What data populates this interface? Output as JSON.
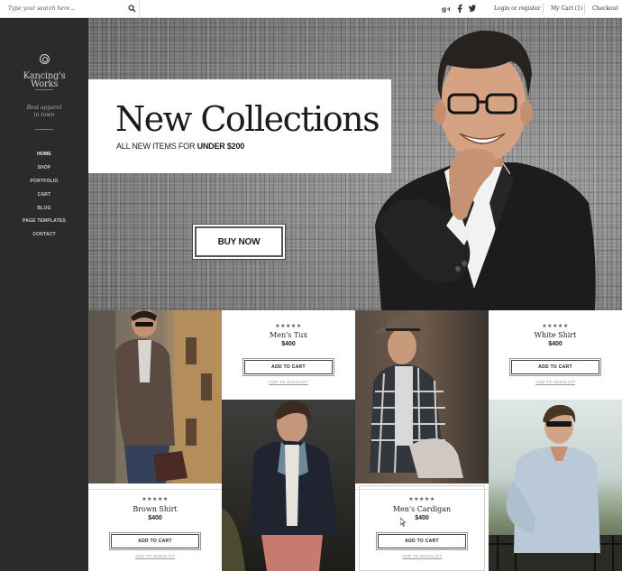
{
  "search": {
    "placeholder": "Type your search here..."
  },
  "header": {
    "social": [
      "google-plus-icon",
      "facebook-icon",
      "twitter-icon"
    ],
    "login": "Login or register",
    "cart": "My Cart (1)",
    "checkout": "Checkout"
  },
  "brand": {
    "line1": "Kancing's",
    "line2": "Works",
    "tagline1": "Best apparel",
    "tagline2": "in town"
  },
  "nav": [
    "HOME",
    "SHOP",
    "PORTFOLIO",
    "CART",
    "BLOG",
    "PAGE TEMPLATES",
    "CONTACT"
  ],
  "hero": {
    "title": "New Collections",
    "subtitle_prefix": "ALL NEW ITEMS FOR ",
    "subtitle_strong": "UNDER $200",
    "button": "BUY NOW"
  },
  "products": [
    {
      "name": "Men's Tux",
      "price": "$400",
      "rating": "★★★★★",
      "add": "ADD TO CART",
      "wish": "ADD TO WISHLIST"
    },
    {
      "name": "White Shirt",
      "price": "$400",
      "rating": "★★★★★",
      "add": "ADD TO CART",
      "wish": "ADD TO WISHLIST"
    },
    {
      "name": "Brown Shirt",
      "price": "$400",
      "rating": "★★★★★",
      "add": "ADD TO CART",
      "wish": "ADD TO WISHLIST"
    },
    {
      "name": "Men's Cardigan",
      "price": "$400",
      "rating": "★★★★★",
      "add": "ADD TO CART",
      "wish": "ADD TO WISHLIST"
    }
  ],
  "colors": {
    "sidebar": "#2b2b2b",
    "hero": "#8e8e8e",
    "text": "#222222"
  }
}
